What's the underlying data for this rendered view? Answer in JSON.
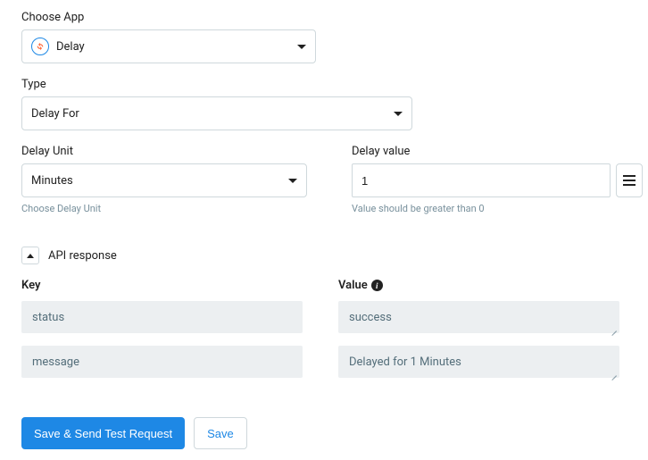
{
  "choose_app": {
    "label": "Choose App",
    "value": "Delay"
  },
  "type": {
    "label": "Type",
    "value": "Delay For"
  },
  "delay_unit": {
    "label": "Delay Unit",
    "value": "Minutes",
    "hint": "Choose Delay Unit"
  },
  "delay_value": {
    "label": "Delay value",
    "value": "1",
    "hint": "Value should be greater than 0"
  },
  "api_response": {
    "label": "API response",
    "key_header": "Key",
    "value_header": "Value",
    "rows": [
      {
        "key": "status",
        "value": "success"
      },
      {
        "key": "message",
        "value": "Delayed for 1 Minutes"
      }
    ]
  },
  "actions": {
    "save_send": "Save & Send Test Request",
    "save": "Save"
  }
}
